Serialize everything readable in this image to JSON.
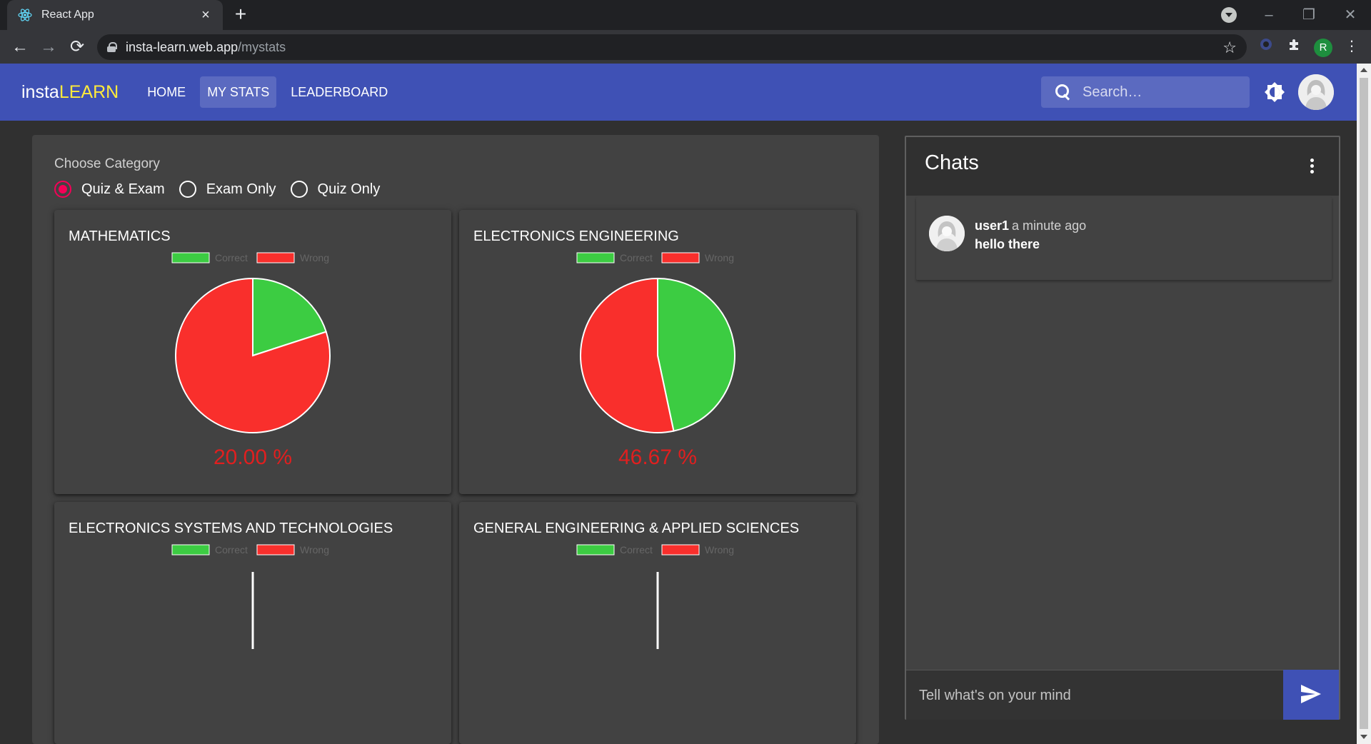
{
  "browser": {
    "tab_title": "React App",
    "url_host": "insta-learn.web.app",
    "url_path": "/mystats"
  },
  "app": {
    "brand_part1": "insta",
    "brand_part2": "LEARN",
    "nav": [
      {
        "label": "HOME",
        "active": false
      },
      {
        "label": "MY STATS",
        "active": true
      },
      {
        "label": "LEADERBOARD",
        "active": false
      }
    ],
    "search_placeholder": "Search…"
  },
  "stats": {
    "category_label": "Choose Category",
    "options": [
      {
        "label": "Quiz & Exam",
        "checked": true
      },
      {
        "label": "Exam Only",
        "checked": false
      },
      {
        "label": "Quiz Only",
        "checked": false
      }
    ],
    "legend_correct": "Correct",
    "legend_wrong": "Wrong"
  },
  "chart_data": [
    {
      "type": "pie",
      "title": "MATHEMATICS",
      "categories": [
        "Correct",
        "Wrong"
      ],
      "values": [
        20.0,
        80.0
      ],
      "colors": [
        "#3ccc42",
        "#f92f2c"
      ],
      "label": "20.00 %"
    },
    {
      "type": "pie",
      "title": "ELECTRONICS ENGINEERING",
      "categories": [
        "Correct",
        "Wrong"
      ],
      "values": [
        46.67,
        53.33
      ],
      "colors": [
        "#3ccc42",
        "#f92f2c"
      ],
      "label": "46.67 %"
    },
    {
      "type": "pie",
      "title": "ELECTRONICS SYSTEMS AND TECHNOLOGIES",
      "categories": [
        "Correct",
        "Wrong"
      ],
      "values": [
        0,
        0
      ],
      "colors": [
        "#3ccc42",
        "#f92f2c"
      ],
      "label": ""
    },
    {
      "type": "pie",
      "title": "GENERAL ENGINEERING & APPLIED SCIENCES",
      "categories": [
        "Correct",
        "Wrong"
      ],
      "values": [
        0,
        0
      ],
      "colors": [
        "#3ccc42",
        "#f92f2c"
      ],
      "label": ""
    }
  ],
  "chat": {
    "title": "Chats",
    "messages": [
      {
        "user": "user1",
        "time": "a minute ago",
        "text": "hello there"
      }
    ],
    "input_placeholder": "Tell what's on your mind"
  },
  "colors": {
    "appbar": "#3f51b5",
    "accent_yellow": "#ffeb3b",
    "radio_accent": "#f50057",
    "correct": "#3ccc42",
    "wrong": "#f92f2c",
    "percent_text": "#e01f1f"
  }
}
